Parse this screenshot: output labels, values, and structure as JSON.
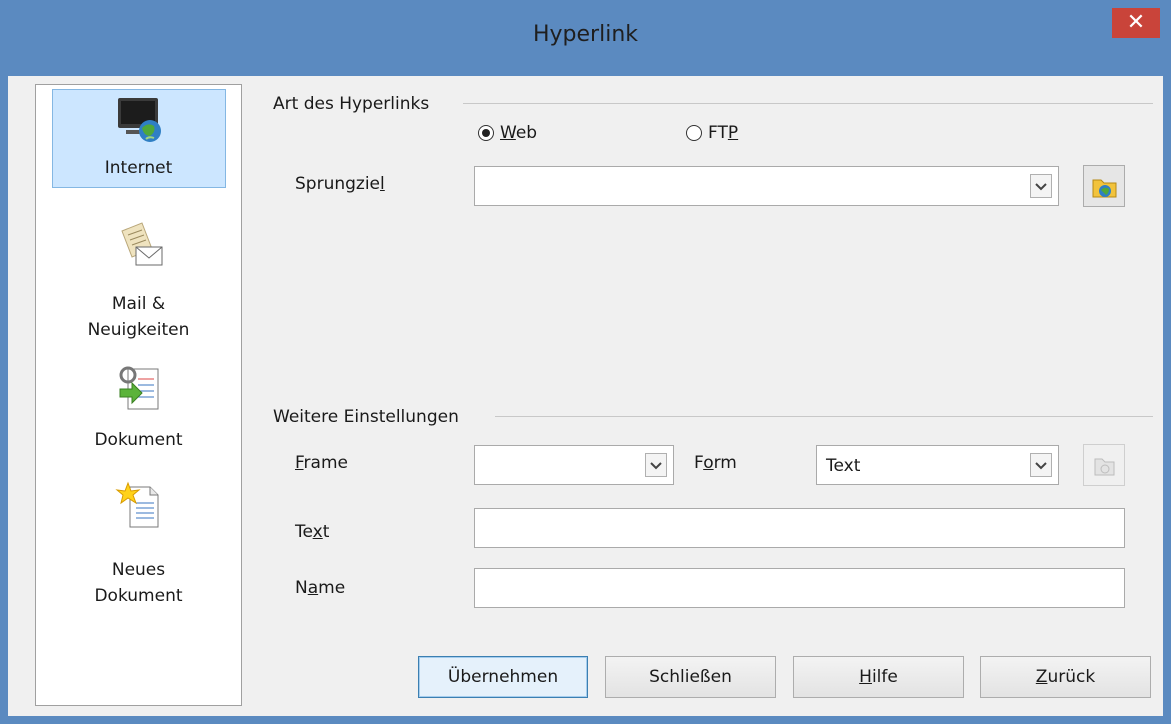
{
  "window": {
    "title": "Hyperlink",
    "close_label": "✕"
  },
  "sidebar": {
    "items": [
      {
        "lines": [
          "Internet"
        ],
        "icon": "internet-globe-icon",
        "selected": true
      },
      {
        "lines": [
          "Mail &",
          "Neuigkeiten"
        ],
        "icon": "mail-icon",
        "selected": false
      },
      {
        "lines": [
          "Dokument"
        ],
        "icon": "document-icon",
        "selected": false
      },
      {
        "lines": [
          "Neues",
          "Dokument"
        ],
        "icon": "new-document-icon",
        "selected": false
      }
    ]
  },
  "hyperlink_type": {
    "group_label": "Art des Hyperlinks",
    "web": {
      "label_pre": "",
      "accel": "W",
      "label_post": "eb",
      "checked": true
    },
    "ftp": {
      "label_pre": "FT",
      "accel": "P",
      "label_post": "",
      "checked": false
    },
    "target": {
      "label_pre": "Sprungzie",
      "accel": "l",
      "label_post": "",
      "value": ""
    }
  },
  "further_settings": {
    "group_label": "Weitere Einstellungen",
    "frame": {
      "label_pre": "",
      "accel": "F",
      "label_post": "rame",
      "value": ""
    },
    "form": {
      "label_pre": "F",
      "accel": "o",
      "label_post": "rm",
      "value": "Text"
    },
    "text": {
      "label_pre": "Te",
      "accel": "x",
      "label_post": "t",
      "value": ""
    },
    "name": {
      "label_pre": "N",
      "accel": "a",
      "label_post": "me",
      "value": ""
    }
  },
  "buttons": {
    "apply": {
      "label_pre": "Übernehmen",
      "accel": "",
      "label_post": ""
    },
    "close": {
      "label_pre": "Schließen",
      "accel": "",
      "label_post": ""
    },
    "help": {
      "label_pre": "",
      "accel": "H",
      "label_post": "ilfe"
    },
    "back": {
      "label_pre": "",
      "accel": "Z",
      "label_post": "urück"
    }
  }
}
